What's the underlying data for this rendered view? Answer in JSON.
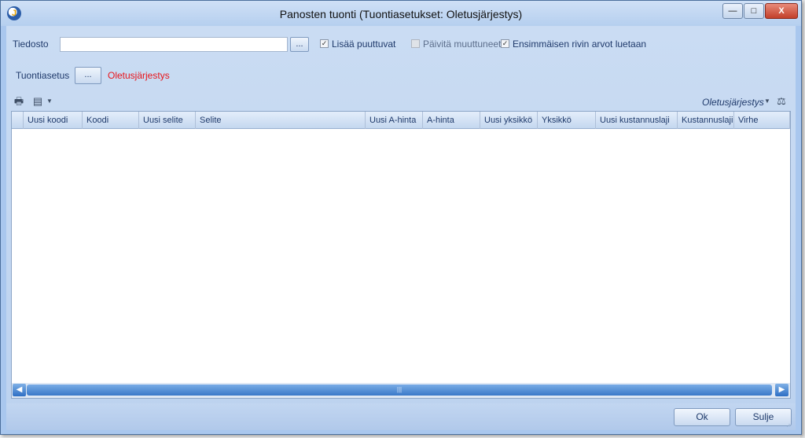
{
  "window": {
    "title": "Panosten tuonti (Tuontiasetukset: Oletusjärjestys)",
    "app_icon_glyph": "J",
    "controls": {
      "minimize": "—",
      "maximize": "□",
      "close": "X"
    }
  },
  "file_row": {
    "label": "Tiedosto",
    "input_value": "",
    "browse_label": "...",
    "options": [
      {
        "label": "Lisää puuttuvat",
        "checked": true,
        "enabled": true
      },
      {
        "label": "Päivitä muuttuneet",
        "checked": false,
        "enabled": false
      },
      {
        "label": "Ensimmäisen rivin arvot luetaan",
        "checked": true,
        "enabled": true
      }
    ]
  },
  "settings_row": {
    "label": "Tuontiasetus",
    "button_label": "...",
    "current_setting": "Oletusjärjestys",
    "current_setting_color": "#e8141a"
  },
  "toolbar": {
    "layout_label": "Oletusjärjestys",
    "icons": [
      "printer-icon",
      "export-icon",
      "dropdown-arrow-icon",
      "layout-edit-icon"
    ]
  },
  "grid": {
    "columns": [
      "Uusi koodi",
      "Koodi",
      "Uusi selite",
      "Selite",
      "Uusi A-hinta",
      "A-hinta",
      "Uusi yksikkö",
      "Yksikkö",
      "Uusi kustannuslaji",
      "Kustannuslaji",
      "Virhe"
    ],
    "rows": []
  },
  "buttons": {
    "ok": "Ok",
    "close": "Sulje"
  }
}
